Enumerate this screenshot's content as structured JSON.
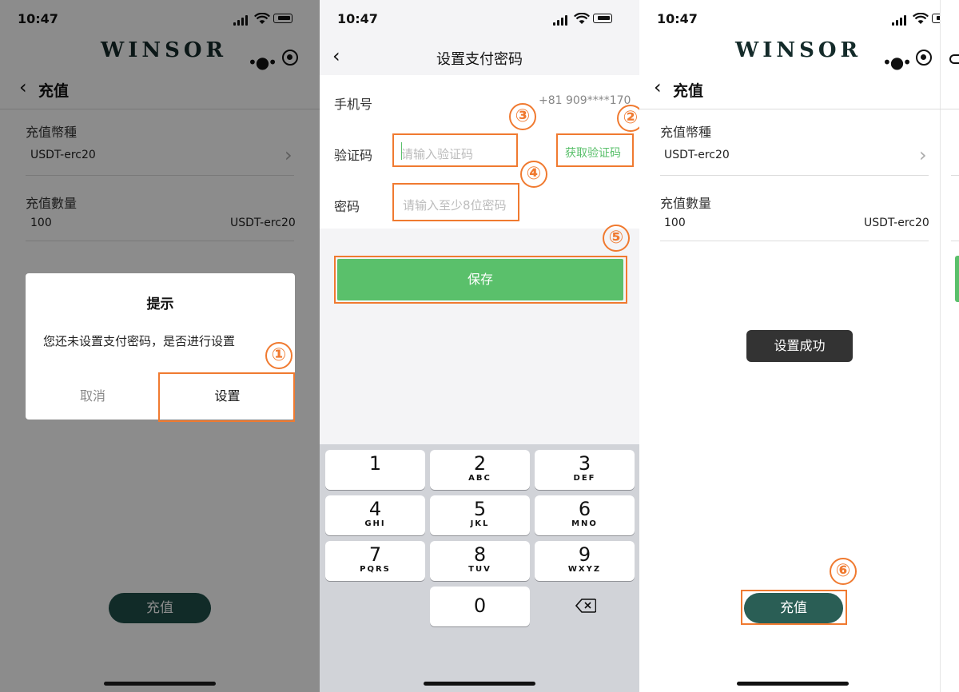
{
  "status_time": "10:47",
  "brand": "WINSOR",
  "screen1": {
    "page_title": "充值",
    "currency_label": "充值幣種",
    "currency_value": "USDT-erc20",
    "amount_label": "充值數量",
    "amount_value": "100",
    "amount_unit": "USDT-erc20",
    "dialog_title": "提示",
    "dialog_message": "您还未设置支付密码，是否进行设置",
    "cancel": "取消",
    "confirm": "设置",
    "recharge_button": "充值",
    "marker": "①"
  },
  "screen2": {
    "page_title": "设置支付密码",
    "phone_label": "手机号",
    "phone_value": "+81 909****170",
    "code_label": "验证码",
    "code_placeholder": "请输入验证码",
    "get_code": "获取验证码",
    "password_label": "密码",
    "password_placeholder": "请输入至少8位密码",
    "save_button": "保存",
    "markers": [
      "②",
      "③",
      "④",
      "⑤"
    ],
    "keys": [
      {
        "digit": "1",
        "letters": ""
      },
      {
        "digit": "2",
        "letters": "ABC"
      },
      {
        "digit": "3",
        "letters": "DEF"
      },
      {
        "digit": "4",
        "letters": "GHI"
      },
      {
        "digit": "5",
        "letters": "JKL"
      },
      {
        "digit": "6",
        "letters": "MNO"
      },
      {
        "digit": "7",
        "letters": "PQRS"
      },
      {
        "digit": "8",
        "letters": "TUV"
      },
      {
        "digit": "9",
        "letters": "WXYZ"
      },
      {
        "digit": "0",
        "letters": ""
      }
    ]
  },
  "screen3": {
    "page_title": "充值",
    "currency_label": "充值幣種",
    "currency_value": "USDT-erc20",
    "amount_label": "充值數量",
    "amount_value": "100",
    "amount_unit": "USDT-erc20",
    "toast": "设置成功",
    "recharge_button": "充值",
    "marker": "⑥"
  },
  "colors": {
    "accent_green": "#5ac06b",
    "brand_dark_green": "#1f4f49",
    "annotation_orange": "#f07a30"
  },
  "icons": [
    "back-chevron-icon",
    "more-dots-icon",
    "target-icon",
    "signal-icon",
    "wifi-icon",
    "battery-icon",
    "delete-key-icon",
    "chevron-right-icon"
  ]
}
